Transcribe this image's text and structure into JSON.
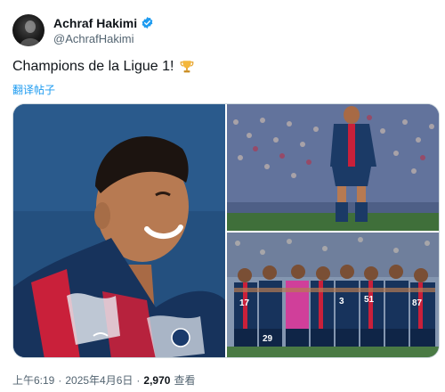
{
  "author": {
    "display_name": "Achraf Hakimi",
    "handle": "@AchrafHakimi",
    "verified_color": "#1d9bf0"
  },
  "tweet": {
    "text": "Champions de la Ligue 1!",
    "emoji": "trophy",
    "translate_label": "翻译帖子"
  },
  "media": {
    "images": [
      {
        "icon": "photo-player-smiling"
      },
      {
        "icon": "photo-player-on-pitch"
      },
      {
        "icon": "photo-team-huddle"
      }
    ],
    "jersey_numbers": [
      "17",
      "3",
      "51",
      "87",
      "29"
    ]
  },
  "meta": {
    "time": "上午6:19",
    "date": "2025年4月6日",
    "views_count": "2,970",
    "views_label": "查看",
    "separator": "·"
  }
}
